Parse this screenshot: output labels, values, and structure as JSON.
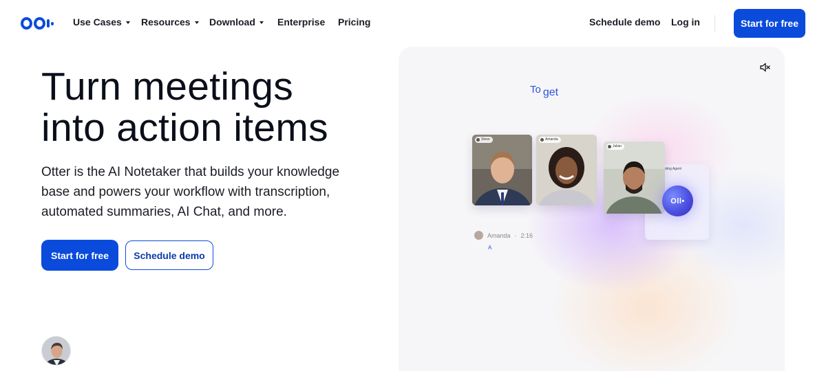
{
  "brand": {
    "logo_text": "Otter",
    "accent": "#0b4bdc"
  },
  "nav": {
    "items": [
      {
        "label": "Use Cases",
        "dropdown": true
      },
      {
        "label": "Resources",
        "dropdown": true
      },
      {
        "label": "Download",
        "dropdown": true
      },
      {
        "label": "Enterprise",
        "dropdown": false
      },
      {
        "label": "Pricing",
        "dropdown": false
      }
    ],
    "schedule_demo": "Schedule demo",
    "log_in": "Log in",
    "cta": "Start for free"
  },
  "hero": {
    "headline_line1": "Turn meetings",
    "headline_line2": "into action items",
    "subtext": "Otter is the AI Notetaker that builds your knowledge base and powers your workflow with transcription, automated summaries, AI Chat, and more.",
    "primary_button": "Start for free",
    "secondary_button": "Schedule demo"
  },
  "demo": {
    "caption_word1": "To",
    "caption_word2": "get",
    "participants": [
      "Steve",
      "Amanda",
      "Julian"
    ],
    "agent_label": "eting Agent",
    "orb_label": "Oll•",
    "transcript_speaker": "Amanda",
    "transcript_time": "2:16",
    "transcript_word": "A",
    "mute_icon": "speaker-muted-icon"
  }
}
